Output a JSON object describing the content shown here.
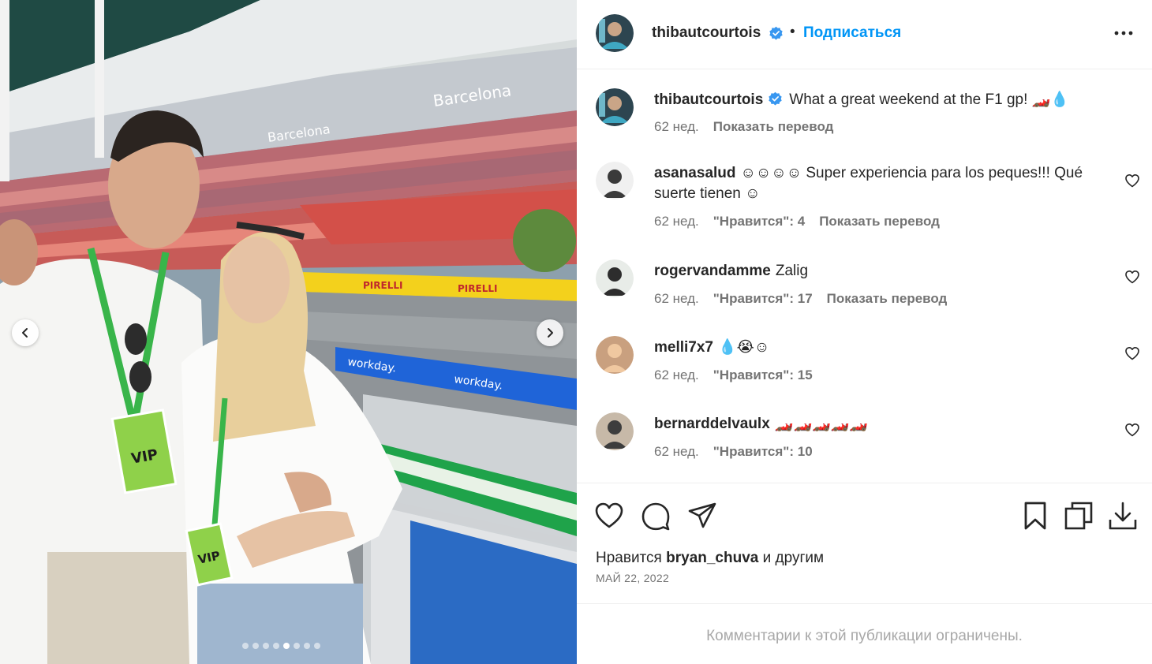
{
  "post": {
    "author": "thibautcourtois",
    "follow_label": "Подписаться",
    "separator": "•",
    "caption": {
      "text": "What a great weekend at the F1 gp! 🏎️💧",
      "age": "62 нед.",
      "translate_label": "Показать перевод"
    },
    "likes": {
      "prefix": "Нравится",
      "user": "bryan_chuva",
      "suffix": "и другим"
    },
    "date": "МАЙ 22, 2022",
    "comments_limited": "Комментарии к этой публикации ограничены."
  },
  "photo_signs": {
    "barcelona_top": "Barcelona",
    "barcelona_mid": "Barcelona",
    "pirelli": "PIRELLI",
    "workday": "workday.",
    "vip": "VIP"
  },
  "comments": [
    {
      "user": "asanasalud",
      "text": "☺☺☺☺ Super experiencia para los peques!!! Qué suerte tienen ☺",
      "age": "62 нед.",
      "likes": "\"Нравится\": 4",
      "translate": "Показать перевод"
    },
    {
      "user": "rogervandamme",
      "text": "Zalig",
      "age": "62 нед.",
      "likes": "\"Нравится\": 17",
      "translate": "Показать перевод"
    },
    {
      "user": "melli7x7",
      "text": "💧😭☺",
      "age": "62 нед.",
      "likes": "\"Нравится\": 15",
      "translate": ""
    },
    {
      "user": "bernarddelvaulx",
      "text": "🏎️🏎️🏎️🏎️🏎️",
      "age": "62 нед.",
      "likes": "\"Нравится\": 10",
      "translate": ""
    }
  ],
  "carousel": {
    "total": 8,
    "active": 4
  },
  "icons": {
    "verified": "verified-badge-icon",
    "more": "more-options-icon",
    "like": "heart-icon",
    "comment": "comment-bubble-icon",
    "share": "paper-plane-icon",
    "save": "bookmark-icon",
    "copy": "copy-icon",
    "download": "download-icon"
  },
  "colors": {
    "link_blue": "#0095f6",
    "verified_blue": "#3897f0",
    "secondary_text": "#737373",
    "primary_text": "#262626"
  }
}
